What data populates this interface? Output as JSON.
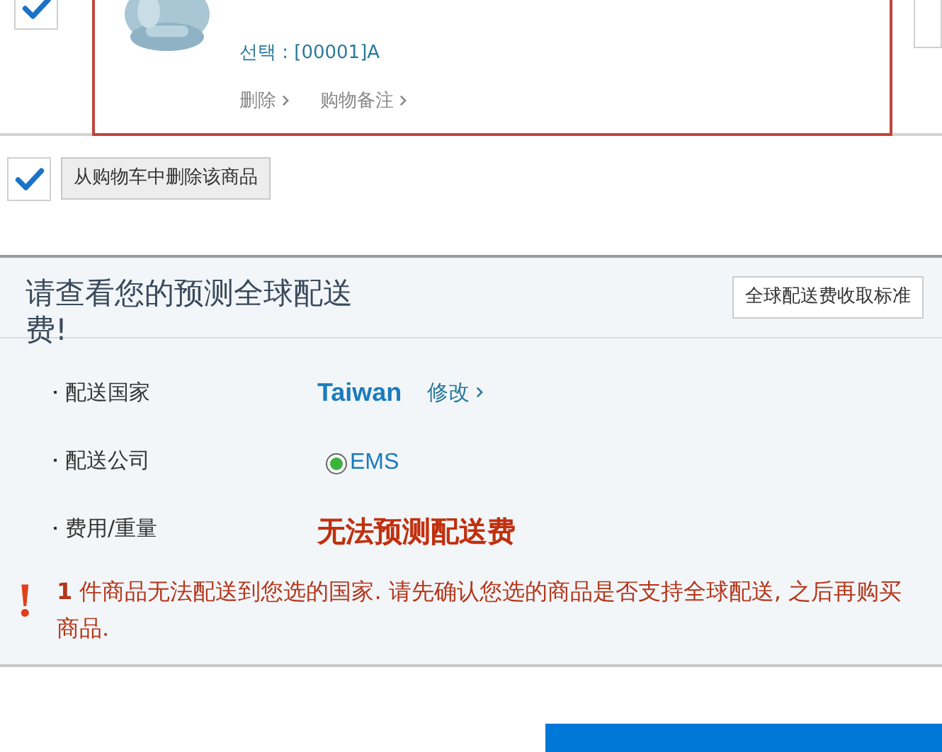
{
  "product": {
    "checked": true,
    "image": {
      "kind": "picture"
    },
    "option": "선택 : [00001]A",
    "actions": [
      "删除",
      "购物备注"
    ]
  },
  "remove_bar": {
    "checked": true,
    "button": "从购物车中删除该商品"
  },
  "shipping": {
    "title": "请查看您的预测全球配送费!",
    "standard_button": "全球配送费收取标准",
    "rows": [
      {
        "kind": "country",
        "label": "配送国家",
        "value": "Taiwan",
        "link": "修改"
      },
      {
        "kind": "carrier",
        "label": "配送公司",
        "options": [
          {
            "label": "EMS",
            "selected": true
          }
        ]
      },
      {
        "kind": "fee",
        "label": "费用/重量",
        "value": "无法预测配送费"
      }
    ],
    "warning": {
      "icon": "!",
      "count": "1",
      "text": "件商品无法配送到您选的国家. 请先确认您选的商品是否支持全球配送, 之后再购买商品."
    }
  }
}
